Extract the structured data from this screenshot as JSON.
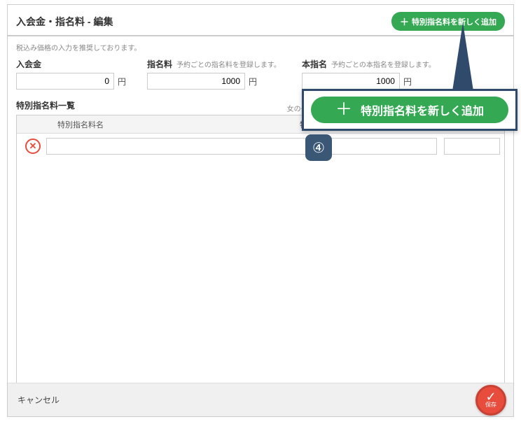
{
  "header": {
    "title": "入会金・指名料 - 編集",
    "add_button": "特別指名料を新しく追加"
  },
  "hints": {
    "tax": "税込み価格の入力を推奨しております。",
    "nomination": "予約ごとの指名料を登録します。",
    "real_nomination": "予約ごとの本指名を登録します。",
    "list": "女の子詳細画面で設定する特別指名料と本指名を紐講してください。"
  },
  "fields": {
    "entry": {
      "label": "入会金",
      "value": "0",
      "unit": "円"
    },
    "nomination": {
      "label": "指名料",
      "value": "1000",
      "unit": "円"
    },
    "real_nomination": {
      "label": "本指名",
      "value": "1000",
      "unit": "円"
    }
  },
  "list": {
    "title": "特別指名料一覧",
    "cols": {
      "name": "特別指名料名",
      "fee": "特別指名料"
    },
    "row": {
      "name": "",
      "fee": ""
    }
  },
  "footer": {
    "cancel": "キャンセル",
    "save": "保存"
  },
  "callout": {
    "button": "特別指名料を新しく追加",
    "step": "④"
  }
}
